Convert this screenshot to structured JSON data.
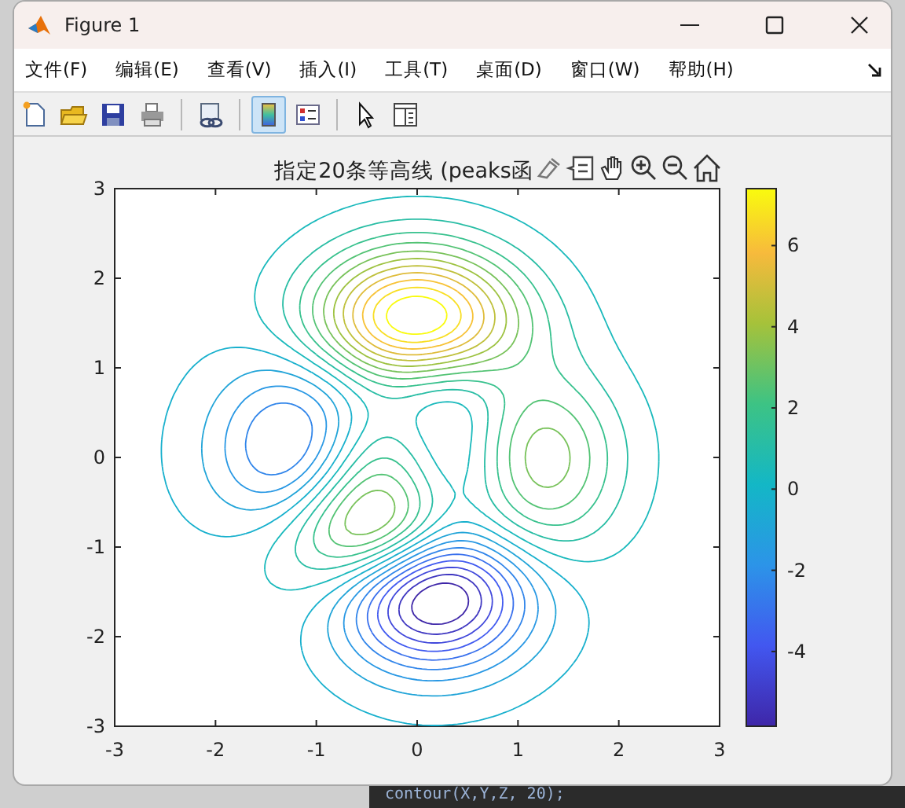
{
  "window": {
    "title": "Figure 1"
  },
  "menu": [
    "文件(F)",
    "编辑(E)",
    "查看(V)",
    "插入(I)",
    "工具(T)",
    "桌面(D)",
    "窗口(W)",
    "帮助(H)"
  ],
  "toolbar": [
    [
      {
        "kind": "new",
        "selected": false
      },
      {
        "kind": "open",
        "selected": false
      },
      {
        "kind": "save",
        "selected": false
      },
      {
        "kind": "print",
        "selected": false
      }
    ],
    [
      {
        "kind": "link",
        "selected": false
      }
    ],
    [
      {
        "kind": "colorbar",
        "selected": true
      },
      {
        "kind": "legend",
        "selected": false
      }
    ],
    [
      {
        "kind": "pointer",
        "selected": false
      },
      {
        "kind": "inspector",
        "selected": false
      }
    ]
  ],
  "axes": {
    "title": "指定20条等高线 (peaks函",
    "toolbar": [
      {
        "kind": "brush"
      },
      {
        "kind": "datatip"
      },
      {
        "kind": "pan"
      },
      {
        "kind": "zoom-in"
      },
      {
        "kind": "zoom-out"
      },
      {
        "kind": "home"
      }
    ],
    "xticks": [
      "-3",
      "-2",
      "-1",
      "0",
      "1",
      "2",
      "3"
    ],
    "yticks": [
      "3",
      "2",
      "1",
      "0",
      "-1",
      "-2",
      "-3"
    ],
    "colorbar_ticks": [
      "6",
      "4",
      "2",
      "0",
      "-2",
      "-4"
    ]
  },
  "code_line": "contour(X,Y,Z, 20);"
}
